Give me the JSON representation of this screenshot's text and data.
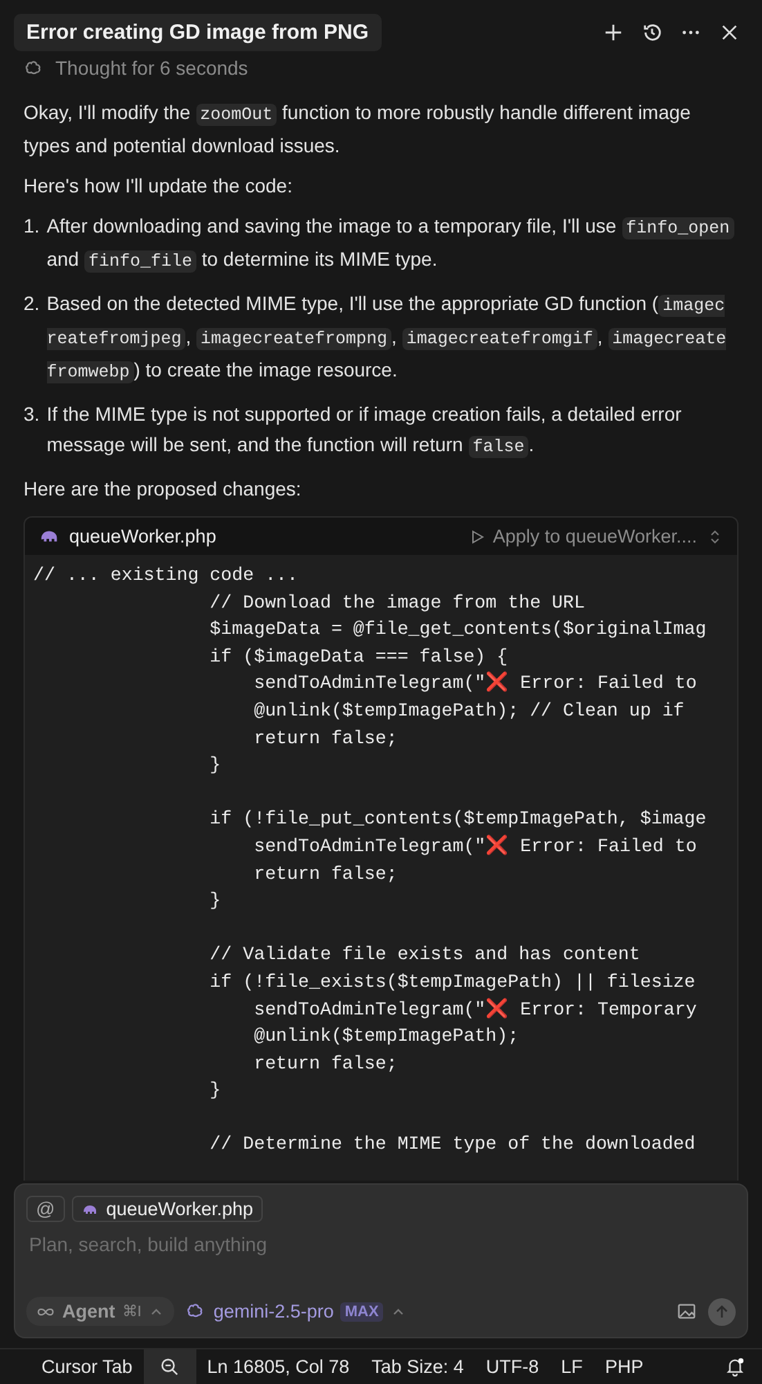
{
  "header": {
    "title": "Error creating GD image from PNG"
  },
  "thought": "Thought for 6 seconds",
  "message": {
    "intro": [
      {
        "text": "Okay, I'll modify the ",
        "code": false
      },
      {
        "text": "zoomOut",
        "code": true
      },
      {
        "text": " function to more robustly handle different image types and potential download issues.",
        "code": false
      }
    ],
    "lead": "Here's how I'll update the code:",
    "steps": [
      {
        "number": "1.",
        "segments": [
          {
            "text": "After downloading and saving the image to a temporary file, I'll use ",
            "code": false
          },
          {
            "text": "finfo_open",
            "code": true
          },
          {
            "text": " and ",
            "code": false
          },
          {
            "text": "finfo_file",
            "code": true
          },
          {
            "text": " to determine its MIME type.",
            "code": false
          }
        ]
      },
      {
        "number": "2.",
        "segments": [
          {
            "text": "Based on the detected MIME type, I'll use the appropriate GD function (",
            "code": false
          },
          {
            "text": "imagecreatefromjpeg",
            "code": true
          },
          {
            "text": ", ",
            "code": false
          },
          {
            "text": "imagecreatefrompng",
            "code": true
          },
          {
            "text": ", ",
            "code": false
          },
          {
            "text": "imagecreatefromgif",
            "code": true
          },
          {
            "text": ", ",
            "code": false
          },
          {
            "text": "imagecreatefromwebp",
            "code": true
          },
          {
            "text": ") to create the image resource.",
            "code": false
          }
        ]
      },
      {
        "number": "3.",
        "segments": [
          {
            "text": "If the MIME type is not supported or if image creation fails, a detailed error message will be sent, and the function will return ",
            "code": false
          },
          {
            "text": "false",
            "code": true
          },
          {
            "text": ".",
            "code": false
          }
        ]
      }
    ],
    "outro": "Here are the proposed changes:"
  },
  "code_block": {
    "filename": "queueWorker.php",
    "apply_label": "Apply to queueWorker....",
    "code": "// ... existing code ...\n                // Download the image from the URL\n                $imageData = @file_get_contents($originalImag\n                if ($imageData === false) {\n                    sendToAdminTelegram(\"❌ Error: Failed to\n                    @unlink($tempImagePath); // Clean up if\n                    return false;\n                }\n\n                if (!file_put_contents($tempImagePath, $image\n                    sendToAdminTelegram(\"❌ Error: Failed to\n                    return false;\n                }\n\n                // Validate file exists and has content\n                if (!file_exists($tempImagePath) || filesize\n                    sendToAdminTelegram(\"❌ Error: Temporary\n                    @unlink($tempImagePath);\n                    return false;\n                }\n\n                // Determine the MIME type of the downloaded"
  },
  "composer": {
    "at": "@",
    "context_file": "queueWorker.php",
    "placeholder": "Plan, search, build anything",
    "mode": "Agent",
    "shortcut": "⌘I",
    "model": "gemini-2.5-pro",
    "model_badge": "MAX",
    "send_disabled": true
  },
  "status_bar": {
    "left": "Cursor Tab",
    "search_active": true,
    "items": [
      "Ln 16805, Col 78",
      "Tab Size: 4",
      "UTF-8",
      "LF",
      "PHP"
    ]
  }
}
